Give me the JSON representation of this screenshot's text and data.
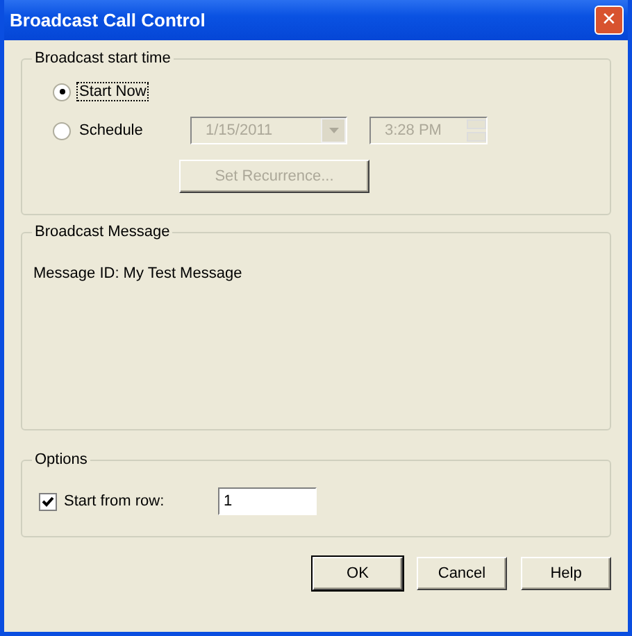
{
  "window": {
    "title": "Broadcast Call Control",
    "close": "✕"
  },
  "start_time": {
    "title": "Broadcast start time",
    "options": [
      {
        "label": "Start Now",
        "selected": true
      },
      {
        "label": "Schedule",
        "selected": false
      }
    ],
    "date": {
      "value": "1/15/2011",
      "disabled": true
    },
    "time": {
      "value": "3:28 PM",
      "disabled": true
    },
    "recurrence_button": {
      "label": "Set Recurrence...",
      "disabled": true
    }
  },
  "message": {
    "title": "Broadcast Message",
    "text": "Message ID: My Test Message"
  },
  "options": {
    "title": "Options",
    "start_from_row": {
      "label": "Start from row:",
      "checked": true,
      "value": "1"
    }
  },
  "buttons": [
    {
      "label": "OK",
      "default": true
    },
    {
      "label": "Cancel",
      "default": false
    },
    {
      "label": "Help",
      "default": false
    }
  ]
}
